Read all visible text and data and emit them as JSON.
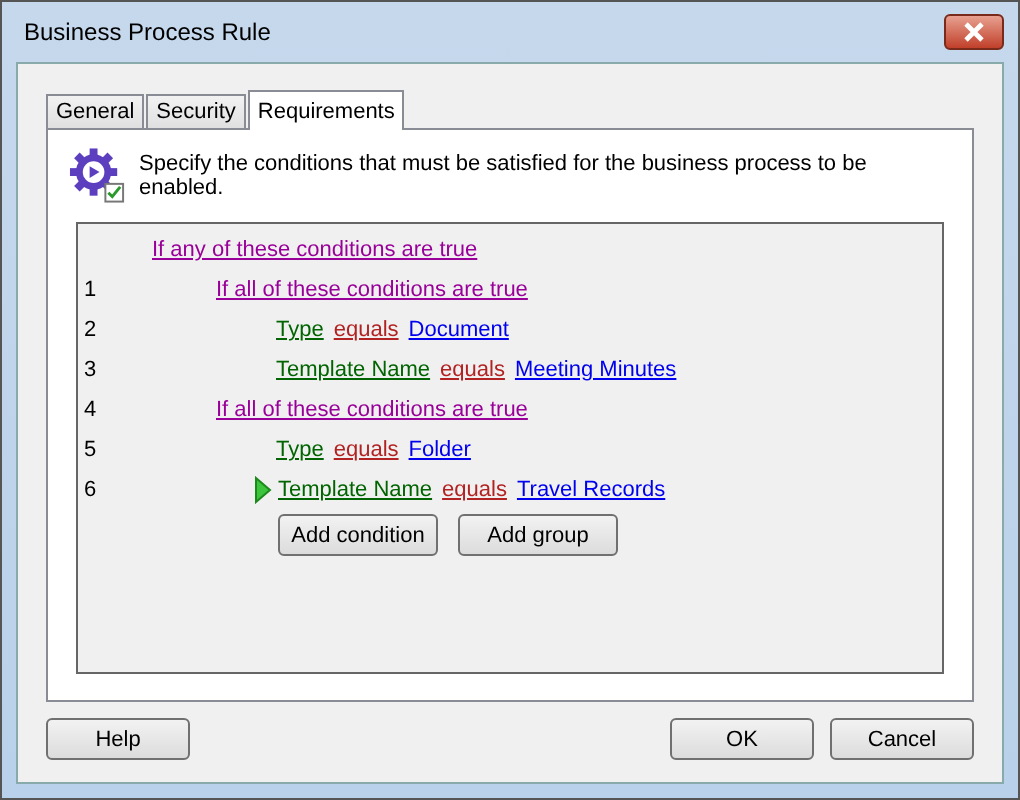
{
  "window": {
    "title": "Business Process Rule"
  },
  "tabs": [
    {
      "label": "General",
      "selected": false
    },
    {
      "label": "Security",
      "selected": false
    },
    {
      "label": "Requirements",
      "selected": true
    }
  ],
  "description": "Specify the conditions that must be satisfied for the business process to be enabled.",
  "rules": {
    "label": "If any of these conditions are true",
    "children": [
      {
        "number": "1",
        "kind": "group",
        "label": "If all of these conditions are true",
        "children": [
          {
            "number": "2",
            "kind": "condition",
            "field": "Type",
            "operator": "equals",
            "value": "Document",
            "current": false
          },
          {
            "number": "3",
            "kind": "condition",
            "field": "Template Name",
            "operator": "equals",
            "value": "Meeting Minutes",
            "current": false
          }
        ]
      },
      {
        "number": "4",
        "kind": "group",
        "label": "If all of these conditions are true",
        "children": [
          {
            "number": "5",
            "kind": "condition",
            "field": "Type",
            "operator": "equals",
            "value": "Folder",
            "current": false
          },
          {
            "number": "6",
            "kind": "condition",
            "field": "Template Name",
            "operator": "equals",
            "value": "Travel Records",
            "current": true
          }
        ]
      }
    ]
  },
  "rule_buttons": [
    "Add condition",
    "Add group"
  ],
  "footer": {
    "left": [
      "Help"
    ],
    "right": [
      "OK",
      "Cancel"
    ]
  }
}
